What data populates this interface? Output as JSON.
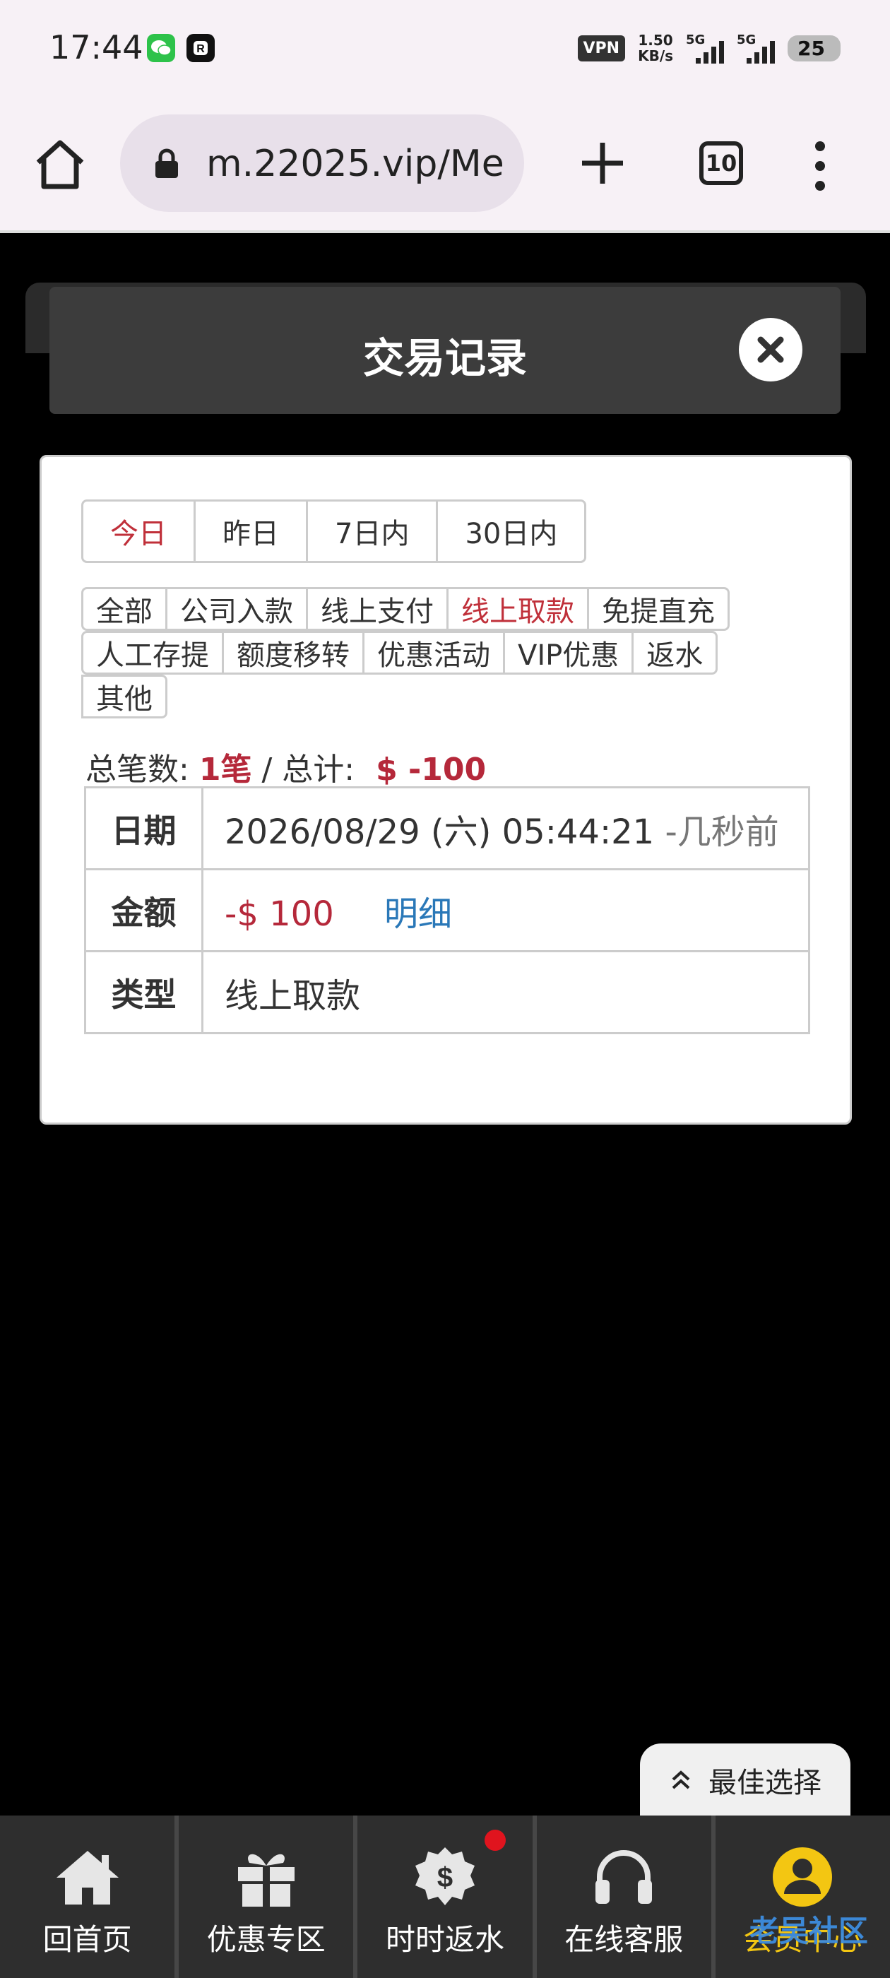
{
  "status_bar": {
    "time": "17:44",
    "vpn": "VPN",
    "speed_value": "1.50",
    "speed_unit": "KB/s",
    "signal1_label": "5G",
    "signal2_label": "5G",
    "battery": "25"
  },
  "browser": {
    "url": "m.22025.vip/Me",
    "tab_count": "10"
  },
  "modal": {
    "title": "交易记录"
  },
  "date_tabs": [
    "今日",
    "昨日",
    "7日内",
    "30日内"
  ],
  "type_tags": {
    "row1": [
      "全部",
      "公司入款",
      "线上支付",
      "线上取款",
      "免提直充"
    ],
    "row2": [
      "人工存提",
      "额度移转",
      "优惠活动",
      "VIP优惠",
      "返水"
    ],
    "row3": [
      "其他"
    ]
  },
  "summary": {
    "count_label": "总笔数:",
    "count_value": "1笔",
    "separator": "/",
    "total_label": "总计:",
    "total_value": "$ -100"
  },
  "record": {
    "date_label": "日期",
    "date_value": "2026/08/29 (六) 05:44:21",
    "date_relative": "-几秒前",
    "amount_label": "金额",
    "amount_value": "-$ 100",
    "detail_link": "明细",
    "type_label": "类型",
    "type_value": "线上取款"
  },
  "floating_button": {
    "label": "最佳选择"
  },
  "bottom_nav": [
    {
      "label": "回首页",
      "icon": "home-icon"
    },
    {
      "label": "优惠专区",
      "icon": "gift-icon"
    },
    {
      "label": "时时返水",
      "icon": "dollar-badge-icon"
    },
    {
      "label": "在线客服",
      "icon": "headset-icon"
    },
    {
      "label": "会员中心",
      "icon": "user-circle-icon"
    }
  ],
  "watermark": "老吴社区",
  "colors": {
    "accent_red": "#c0303a",
    "link_blue": "#2a78b8",
    "active_nav": "#f3c612"
  }
}
